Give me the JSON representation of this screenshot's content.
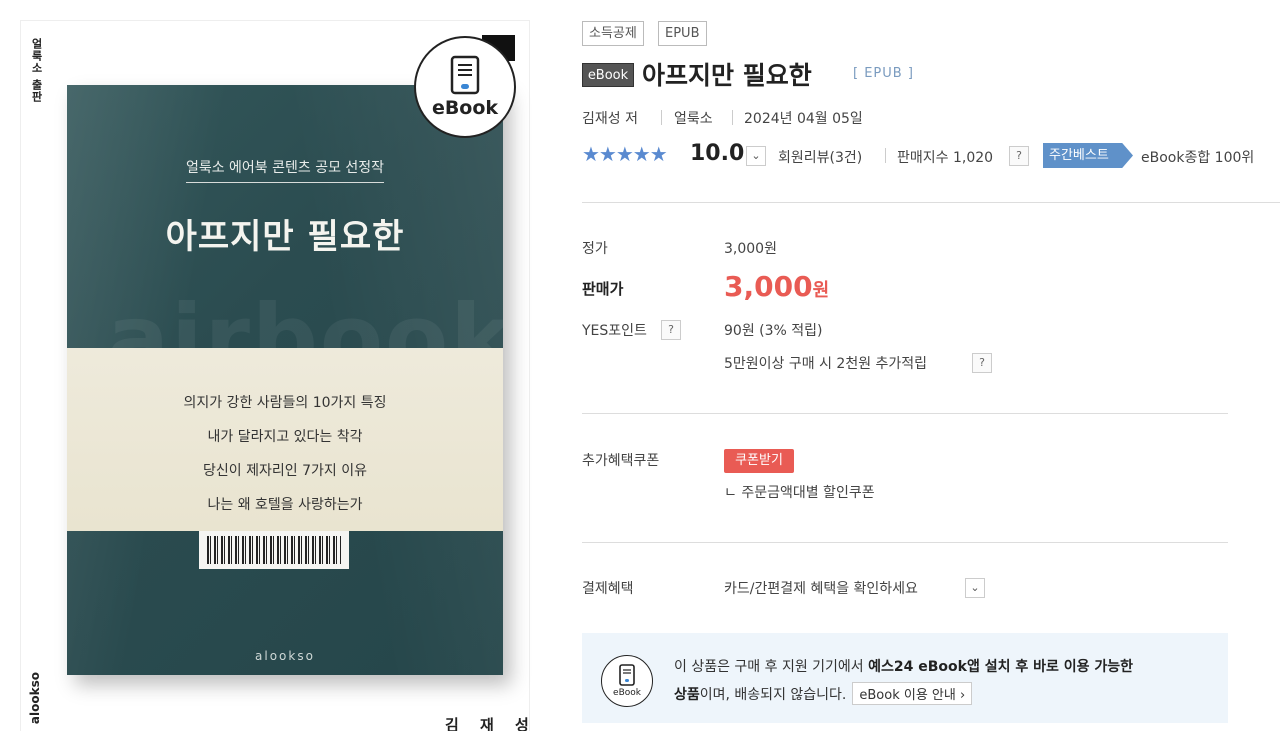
{
  "cover": {
    "spine_top": "얼룩소 출판",
    "spine_bottom": "alookso",
    "back_author": "김 재 성",
    "subtitle": "얼룩소 에어북 콘텐츠 공모 선정작",
    "title": "아프지만 필요한",
    "watermark": "airbook",
    "band_lines": [
      "의지가 강한 사람들의 10가지 특징",
      "내가 달라지고 있다는 착각",
      "당신이 제자리인 7가지 이유",
      "나는 왜 호텔을 사랑하는가"
    ],
    "brand": "alookso",
    "badge_text": "eBook"
  },
  "tags": [
    "소득공제",
    "EPUB"
  ],
  "product": {
    "ebook_label": "eBook",
    "title": "아프지만 필요한",
    "format": "[ EPUB ]",
    "author": "김재성 저",
    "publisher": "얼룩소",
    "date": "2024년 04월 05일"
  },
  "rating": {
    "stars": "★★★★★",
    "score": "10.0",
    "reviews": "회원리뷰(3건)",
    "sales_index": "판매지수 1,020",
    "weekly_best": "주간베스트",
    "rank": "eBook종합 100위",
    "score_value": 10.0
  },
  "price": {
    "list_label": "정가",
    "list_value": "3,000원",
    "sale_label": "판매가",
    "sale_value": "3,000",
    "sale_unit": "원",
    "points_label": "YES포인트",
    "points_value": "90원 (3% 적립)",
    "points_extra": "5만원이상 구매 시 2천원 추가적립"
  },
  "coupon": {
    "label": "추가혜택쿠폰",
    "button": "쿠폰받기",
    "sub": "ㄴ 주문금액대별 할인쿠폰"
  },
  "payment": {
    "label": "결제혜택",
    "value": "카드/간편결제 혜택을 확인하세요"
  },
  "notice": {
    "icon_text": "eBook",
    "line1_pre": "이 상품은 구매 후 지원 기기에서 ",
    "line1_bold": "예스24 eBook앱 설치 후 바로 이용 가능한",
    "line2_bold": "상품",
    "line2_post": "이며, 배송되지 않습니다.",
    "guide": "eBook 이용 안내 ›"
  },
  "icons": {
    "question": "?",
    "dropdown": "⌄"
  },
  "colors": {
    "accent_red": "#e95b54",
    "star_blue": "#5a8ad0",
    "best_blue": "#5f91c9",
    "cover_green": "#2b4c50",
    "notice_bg": "#eef5fb"
  }
}
